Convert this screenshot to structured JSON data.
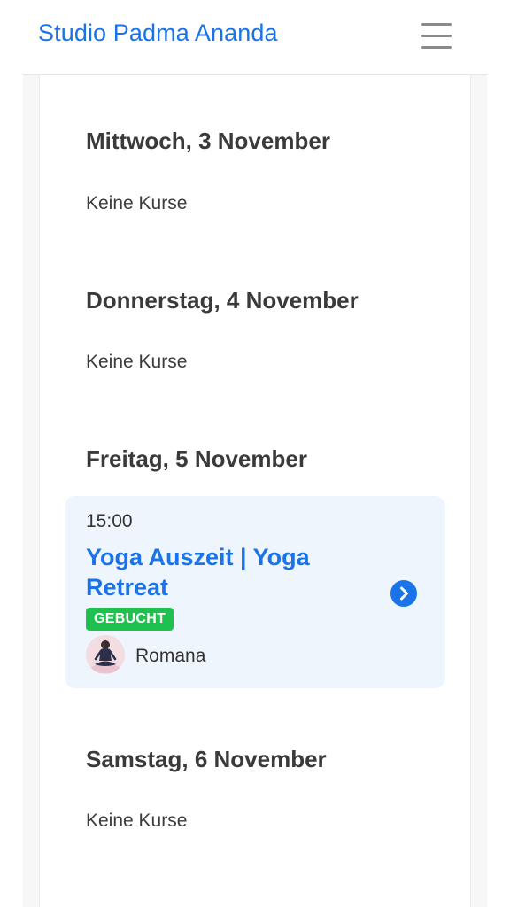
{
  "header": {
    "brand": "Studio Padma Ananda",
    "menu_icon": "hamburger-menu-icon"
  },
  "days": [
    {
      "heading": "Mittwoch, 3 November",
      "empty_text": "Keine Kurse"
    },
    {
      "heading": "Donnerstag, 4 November",
      "empty_text": "Keine Kurse"
    },
    {
      "heading": "Freitag, 5 November"
    },
    {
      "heading": "Samstag, 6 November",
      "empty_text": "Keine Kurse"
    }
  ],
  "event": {
    "time": "15:00",
    "title": "Yoga Auszeit | Yoga Retreat",
    "status": "GEBUCHT",
    "teacher": "Romana",
    "detail_icon": "chevron-right-icon"
  },
  "colors": {
    "brand": "#1a73e8",
    "booked_badge": "#1fc14e",
    "event_card_bg": "#eef5fd",
    "heading_text": "#3a3a3a"
  }
}
